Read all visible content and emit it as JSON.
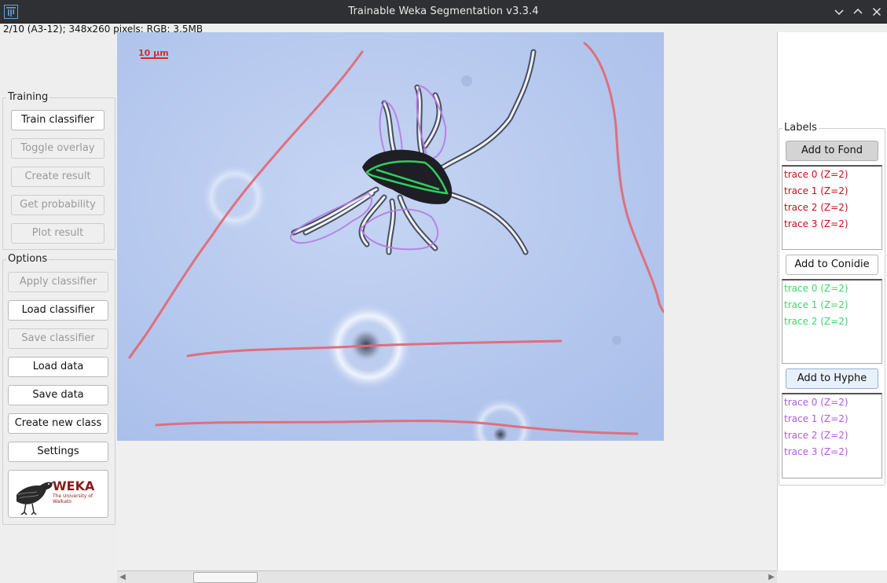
{
  "window": {
    "title": "Trainable Weka Segmentation v3.3.4",
    "controls": {
      "minimize": "﹀",
      "maximize": "︿",
      "close": "✕"
    }
  },
  "image_info": "2/10 (A3-12); 348x260 pixels; RGB; 3.5MB",
  "scale_bar": "10 µm",
  "training": {
    "title": "Training",
    "buttons": [
      "Train classifier",
      "Toggle overlay",
      "Create result",
      "Get probability",
      "Plot result"
    ]
  },
  "options": {
    "title": "Options",
    "buttons": [
      "Apply classifier",
      "Load classifier",
      "Save classifier",
      "Load data",
      "Save data",
      "Create new class",
      "Settings"
    ]
  },
  "logo": {
    "name": "WEKA",
    "subtitle": "The University of Waikato"
  },
  "labels": {
    "title": "Labels",
    "classes": [
      {
        "button": "Add to Fond",
        "color": "#c4101a",
        "traces": [
          "trace 0 (Z=2)",
          "trace 1 (Z=2)",
          "trace 2 (Z=2)",
          "trace 3 (Z=2)"
        ]
      },
      {
        "button": "Add to Conidie",
        "color": "#3fd66a",
        "traces": [
          "trace 0 (Z=2)",
          "trace 1 (Z=2)",
          "trace 2 (Z=2)"
        ]
      },
      {
        "button": "Add to Hyphe",
        "color": "#b15be0",
        "traces": [
          "trace 0 (Z=2)",
          "trace 1 (Z=2)",
          "trace 2 (Z=2)",
          "trace 3 (Z=2)"
        ]
      }
    ]
  },
  "colors": {
    "fond": "#e26a78",
    "conidie": "#2ed05c",
    "hyphe": "#b87ae6",
    "canvas_bg": "#b5c8ef"
  }
}
